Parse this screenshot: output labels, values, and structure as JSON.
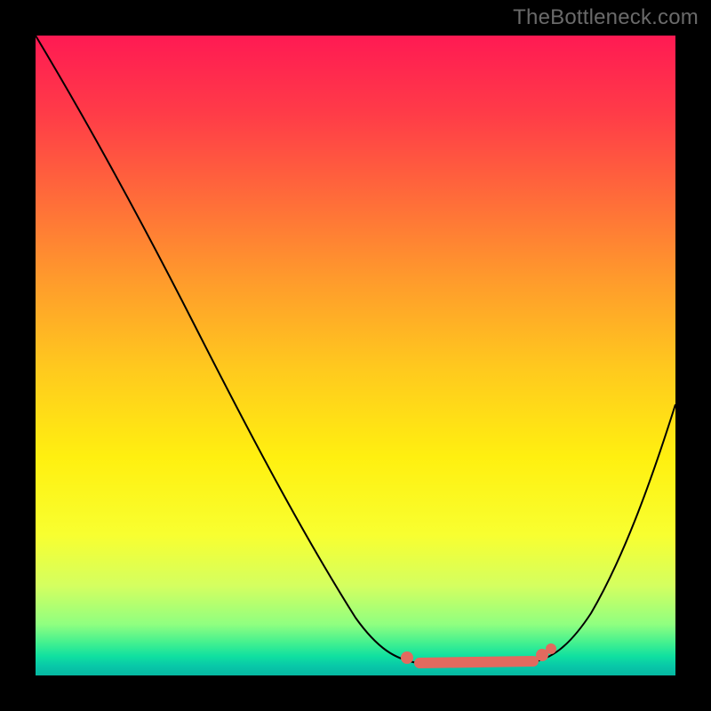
{
  "watermark": "TheBottleneck.com",
  "chart_data": {
    "type": "line",
    "title": "",
    "xlabel": "",
    "ylabel": "",
    "xlim": [
      0,
      100
    ],
    "ylim": [
      0,
      100
    ],
    "grid": false,
    "legend": false,
    "series": [
      {
        "name": "bottleneck-curve",
        "x": [
          0,
          10,
          20,
          30,
          40,
          50,
          55,
          60,
          65,
          70,
          75,
          80,
          85,
          90,
          95,
          100
        ],
        "y": [
          100,
          84,
          68,
          52,
          36,
          20,
          12,
          4,
          2,
          2,
          2,
          4,
          12,
          25,
          40,
          55
        ]
      }
    ],
    "highlight_range": {
      "x_start": 60,
      "x_end": 78,
      "y": 2,
      "color": "#e26a5f"
    },
    "background_gradient": {
      "top": "#ff1a53",
      "mid": "#fff010",
      "bottom": "#06b8a2"
    }
  }
}
